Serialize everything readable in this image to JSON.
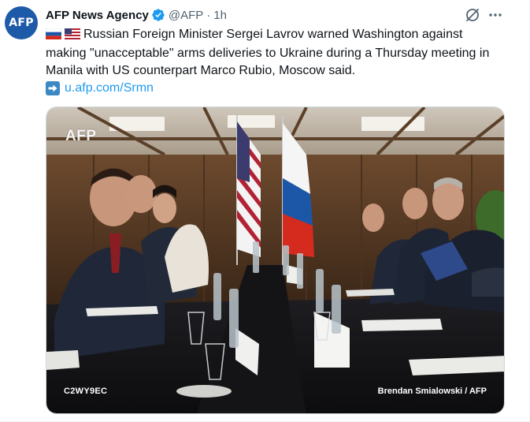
{
  "author": {
    "avatar_text": "AFP",
    "name": "AFP News Agency",
    "handle": "@AFP",
    "separator": "·",
    "time": "1h",
    "verified": true
  },
  "tweet": {
    "flags": [
      "russia-flag",
      "usa-flag"
    ],
    "text": "Russian Foreign Minister Sergei Lavrov warned Washington against making \"unacceptable\" arms deliveries to Ukraine during a Thursday meeting in Manila with US counterpart Marco Rubio, Moscow said.",
    "link_text": "u.afp.com/Srmn"
  },
  "media": {
    "watermark": "AFP",
    "photo_id": "C2WY9EC",
    "credit": "Brendan Smialowski / AFP"
  },
  "colors": {
    "accent": "#1d9bf0",
    "text": "#0f1419",
    "muted": "#536471",
    "verified": "#1d9bf0"
  }
}
